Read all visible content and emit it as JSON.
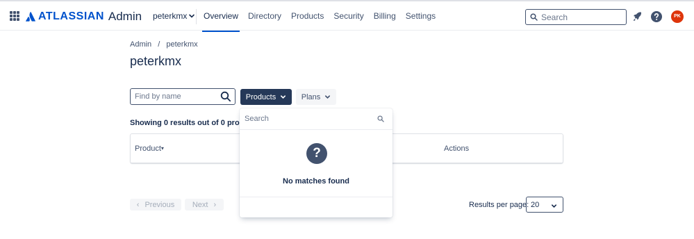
{
  "header": {
    "logo_text": "ATLASSIAN",
    "product_name": "Admin",
    "org_name": "peterkmx",
    "nav": [
      {
        "label": "Overview",
        "active": true
      },
      {
        "label": "Directory",
        "active": false
      },
      {
        "label": "Products",
        "active": false
      },
      {
        "label": "Security",
        "active": false
      },
      {
        "label": "Billing",
        "active": false
      },
      {
        "label": "Settings",
        "active": false
      }
    ],
    "search_placeholder": "Search",
    "avatar_initials": "PK",
    "avatar_color": "#de350b",
    "brand_color": "#0052cc"
  },
  "breadcrumb": {
    "root": "Admin",
    "separator": "/",
    "current": "peterkmx"
  },
  "page_title": "peterkmx",
  "filters": {
    "find_placeholder": "Find by name",
    "products_label": "Products",
    "plans_label": "Plans"
  },
  "results_summary": "Showing 0 results out of 0 products",
  "table": {
    "columns": [
      "Product",
      "Actions"
    ]
  },
  "pagination": {
    "previous_label": "Previous",
    "next_label": "Next",
    "rows_label": "Results per page:",
    "rows_value": "20"
  },
  "products_dropdown": {
    "search_placeholder": "Search",
    "empty_icon": "?",
    "empty_text": "No matches found"
  }
}
